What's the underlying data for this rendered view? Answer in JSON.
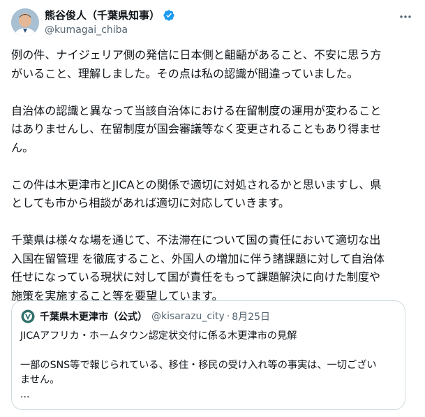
{
  "author": {
    "display_name": "熊谷俊人（千葉県知事）",
    "handle": "@kumagai_chiba"
  },
  "post": {
    "paragraphs": [
      [
        "例の件、ナイジェリア側の発信に日本側と齟齬があること、不安に思う方",
        "がいること、理解しました。その点は私の認識が間違っていました。"
      ],
      [
        "自治体の認識と異なって当該自治体における在留制度の運用が変わること",
        "はありませんし、在留制度が国会審議等なく変更されることもあり得ませ",
        "ん。"
      ],
      [
        "この件は木更津市とJICAとの関係で適切に対処されるかと思いますし、県",
        "としても市から相談があれば適切に対応していきます。"
      ],
      [
        "千葉県は様々な場を通じて、不法滞在について国の責任において適切な出",
        "入国在留管理 を徹底すること、外国人の増加に伴う諸課題に対して自治体",
        "任せになっている現状に対して国が責任をもって課題解決に向けた制度や",
        "施策を実施すること等を要望しています。"
      ]
    ]
  },
  "quote": {
    "name": "千葉県木更津市（公式）",
    "handle": "@kisarazu_city",
    "dot": "·",
    "date": "8月25日",
    "title": "JICAアフリカ・ホームタウン認定状交付に係る木更津市の見解",
    "body_lines": [
      "一部のSNS等で報じられている、移住・移民の受け入れ等の事実は、一切ござい",
      "ません。"
    ],
    "ellipsis": "..."
  },
  "icons": {
    "verified": "verified-badge-icon",
    "more": "more-options-icon",
    "quote_logo": "kisarazu-city-logo-icon"
  },
  "colors": {
    "verified": "#1d9bf0",
    "secondary_text": "#536471",
    "border": "#cfd9de",
    "logo": "#2f6f6a"
  }
}
